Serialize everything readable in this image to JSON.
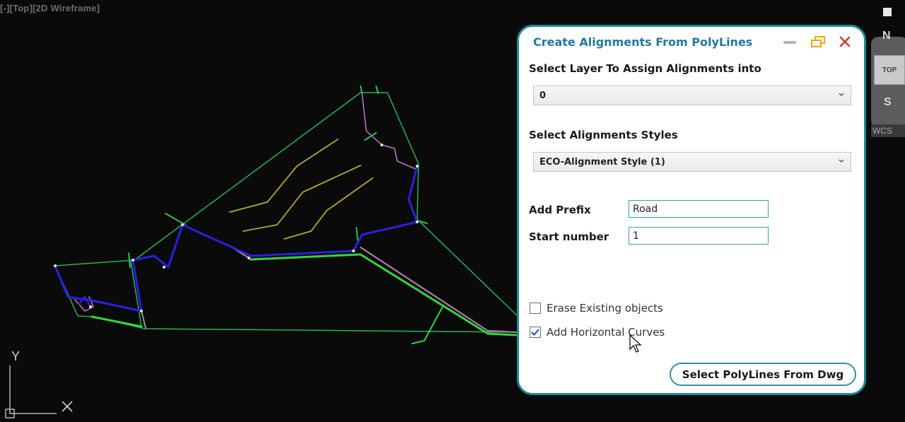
{
  "viewport": {
    "label": "[-][Top][2D Wireframe]"
  },
  "navigation": {
    "compass_north": "N",
    "compass_south": "S",
    "viewcube_face": "TOP",
    "ucs_label": "WCS",
    "ucs_axis_y": "Y"
  },
  "dialog": {
    "title": "Create Alignments From PolyLines",
    "icons": {
      "minimize": "minimize-icon",
      "restore": "restore-icon",
      "close": "close-icon"
    },
    "colors": {
      "title": "#2478a0",
      "border": "#1d8a96",
      "close": "#d83a2f",
      "restore": "#f0a800"
    },
    "layer": {
      "label": "Select Layer To Assign Alignments into",
      "selected": "0"
    },
    "style": {
      "label": "Select Alignments Styles",
      "selected": "ECO-Alignment Style (1)"
    },
    "prefix": {
      "label": "Add Prefix",
      "value": "Road"
    },
    "start_number": {
      "label": "Start number",
      "value": "1"
    },
    "erase_existing": {
      "label": "Erase Existing objects",
      "checked": false
    },
    "horizontal_curves": {
      "label": "Add Horizontal Curves",
      "checked": true
    },
    "select_button": {
      "label": "Select PolyLines From Dwg"
    }
  }
}
